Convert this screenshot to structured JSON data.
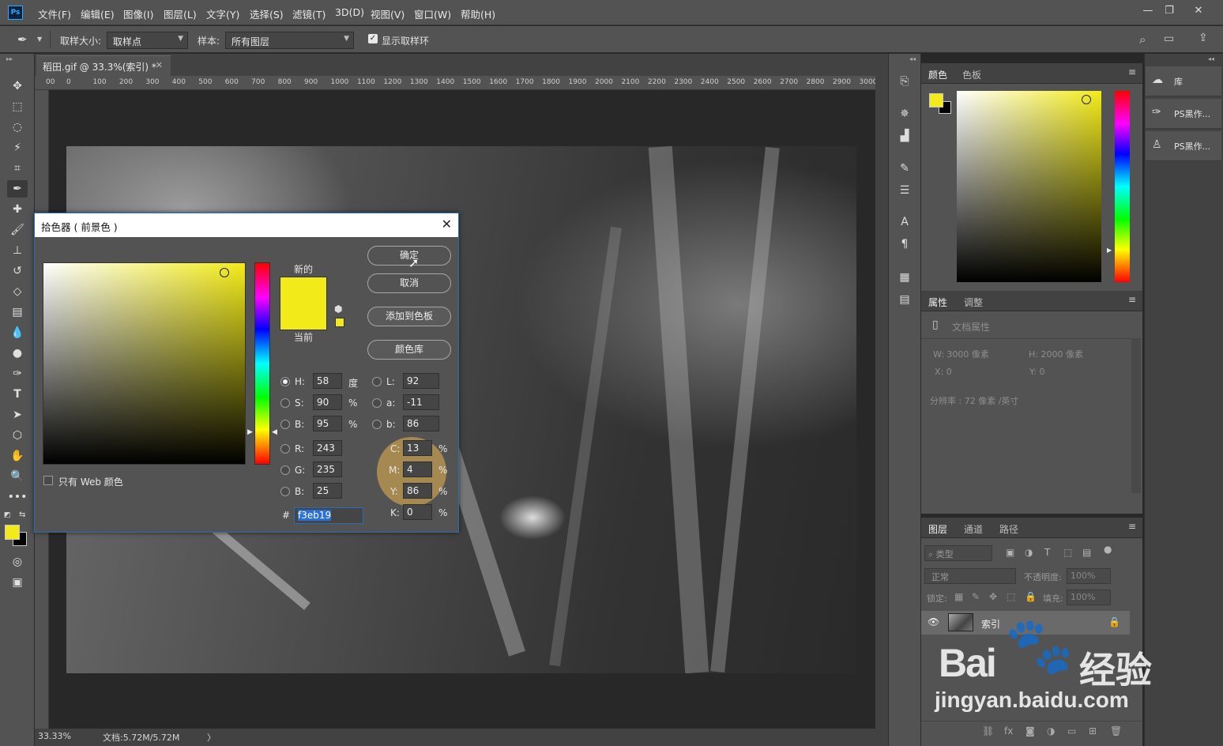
{
  "app": {
    "logo": "Ps"
  },
  "menu": [
    "文件(F)",
    "编辑(E)",
    "图像(I)",
    "图层(L)",
    "文字(Y)",
    "选择(S)",
    "滤镜(T)",
    "3D(D)",
    "视图(V)",
    "窗口(W)",
    "帮助(H)"
  ],
  "window_controls": [
    "minimize-icon",
    "restore-icon",
    "close-icon"
  ],
  "options": {
    "sample_size_label": "取样大小:",
    "sample_size_value": "取样点",
    "sample_label": "样本:",
    "sample_value": "所有图层",
    "show_ring_label": "显示取样环",
    "show_ring_checked": true
  },
  "document": {
    "tab_title": "稻田.gif @ 33.3%(索引) *",
    "ruler_ticks": [
      "00",
      "0",
      "100",
      "200",
      "300",
      "400",
      "500",
      "600",
      "700",
      "800",
      "900",
      "1000",
      "1100",
      "1200",
      "1300",
      "1400",
      "1500",
      "1600",
      "1700",
      "1800",
      "1900",
      "2000",
      "2100",
      "2200",
      "2300",
      "2400",
      "2500",
      "2600",
      "2700",
      "2800",
      "2900",
      "3000"
    ]
  },
  "status": {
    "zoom": "33.33%",
    "doc_info": "文档:5.72M/5.72M",
    "arrow": "〉"
  },
  "dialog": {
    "title": "拾色器 ( 前景色 )",
    "new_label": "新的",
    "current_label": "当前",
    "new_color": "#f3eb19",
    "buttons": {
      "ok": "确定",
      "cancel": "取消",
      "add_swatch": "添加到色板",
      "color_libraries": "颜色库"
    },
    "web_only_label": "只有 Web 颜色",
    "fields": {
      "H": {
        "label": "H:",
        "value": "58",
        "unit": "度"
      },
      "S": {
        "label": "S:",
        "value": "90",
        "unit": "%"
      },
      "B": {
        "label": "B:",
        "value": "95",
        "unit": "%"
      },
      "L": {
        "label": "L:",
        "value": "92"
      },
      "a": {
        "label": "a:",
        "value": "-11"
      },
      "b": {
        "label": "b:",
        "value": "86"
      },
      "R": {
        "label": "R:",
        "value": "243"
      },
      "G": {
        "label": "G:",
        "value": "235"
      },
      "Bl": {
        "label": "B:",
        "value": "25"
      },
      "C": {
        "label": "C:",
        "value": "13",
        "unit": "%"
      },
      "M": {
        "label": "M:",
        "value": "4",
        "unit": "%"
      },
      "Y": {
        "label": "Y:",
        "value": "86",
        "unit": "%"
      },
      "K": {
        "label": "K:",
        "value": "0",
        "unit": "%"
      }
    },
    "hex_label": "#",
    "hex_value": "f3eb19"
  },
  "color_panel": {
    "tabs": [
      "颜色",
      "色板"
    ],
    "foreground": "#f3eb19",
    "background": "#000000"
  },
  "properties_panel": {
    "tabs": [
      "属性",
      "调整"
    ],
    "header": "文档属性",
    "w": "W:  3000 像素",
    "h": "H:  2000 像素",
    "x": "X:  0",
    "y": "Y:  0",
    "resolution": "分辨率 : 72 像素 /英寸"
  },
  "layers_panel": {
    "tabs": [
      "图层",
      "通道",
      "路径"
    ],
    "filter_label": "类型",
    "blend_mode": "正常",
    "opacity_label": "不透明度:",
    "opacity_value": "100%",
    "lock_label": "锁定:",
    "fill_label": "填充:",
    "fill_value": "100%",
    "layer_name": "索引"
  },
  "libraries": {
    "items": [
      "库",
      "PS黑作...",
      "PS黑作..."
    ]
  },
  "watermark": {
    "brand": "Bai",
    "brand2": "经验",
    "url": "jingyan.baidu.com"
  }
}
